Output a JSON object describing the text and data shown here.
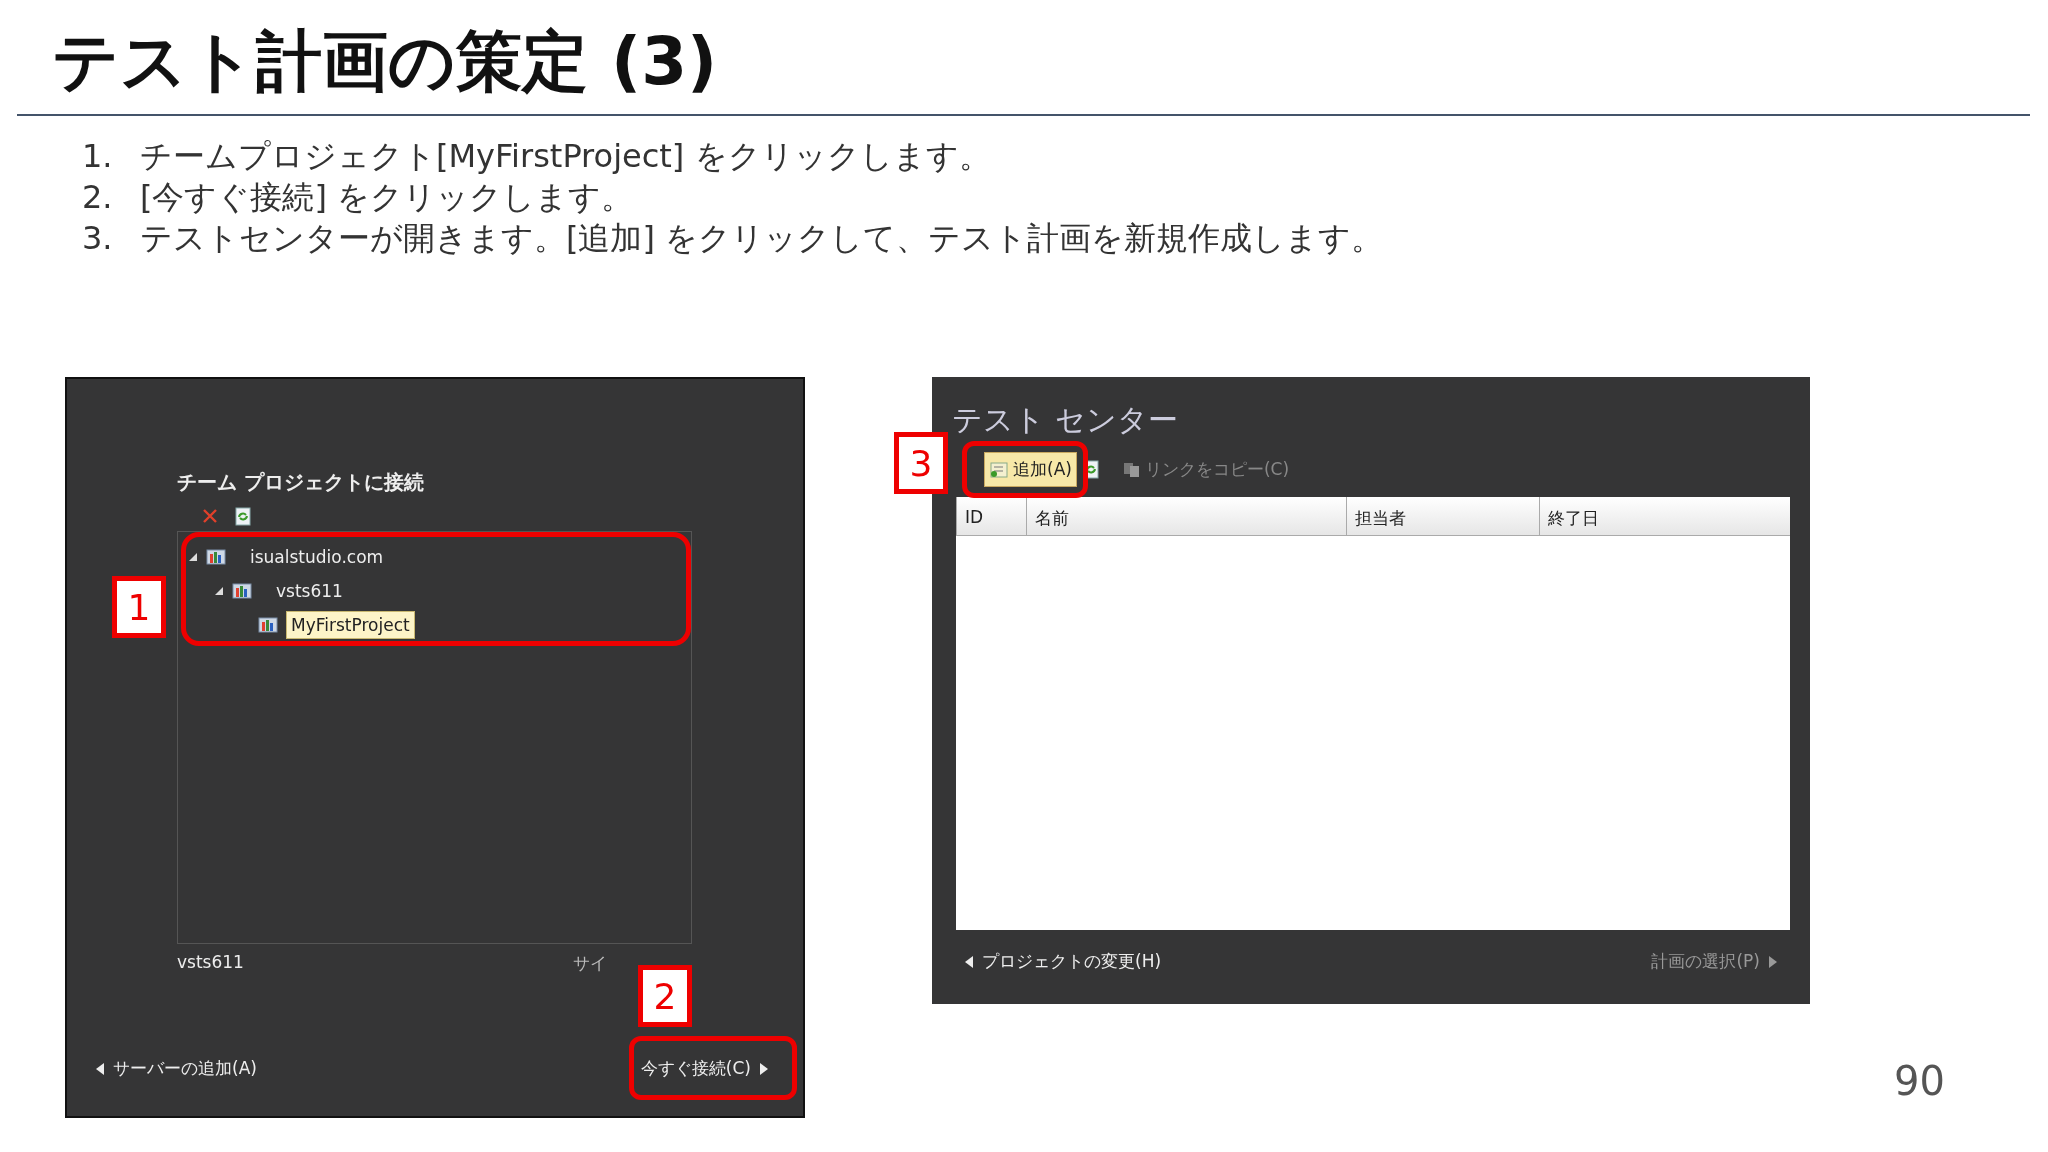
{
  "slide": {
    "title": "テスト計画の策定 (3)",
    "steps": [
      {
        "number": "1.",
        "text": "チームプロジェクト[MyFirstProject] をクリックします。"
      },
      {
        "number": "2.",
        "text": "[今すぐ接続] をクリックします。"
      },
      {
        "number": "3.",
        "text": "テストセンターが開きます。[追加] をクリックして、テスト計画を新規作成します。"
      }
    ],
    "page_number": "90"
  },
  "connect_dialog": {
    "heading": "チーム プロジェクトに接続",
    "tree": [
      {
        "label": "isualstudio.com",
        "expanded": true,
        "selected": false,
        "children": [
          {
            "label": "vsts611",
            "expanded": true,
            "selected": false,
            "children": [
              {
                "label": "MyFirstProject",
                "selected": true
              }
            ]
          }
        ]
      }
    ],
    "user": "vsts611",
    "sign_out": "サイ",
    "back_link": "サーバーの追加(A)",
    "next_button": "今すぐ接続(C)"
  },
  "test_center": {
    "title": "テスト センター",
    "toolbar": [
      {
        "label": "追加(A)",
        "disabled": false
      },
      {
        "label": "リンクをコピー(C)",
        "disabled": true
      }
    ],
    "columns": [
      "ID",
      "名前",
      "担当者",
      "終了日"
    ],
    "back_link": "プロジェクトの変更(H)",
    "next_link": "計画の選択(P)",
    "next_disabled": true
  },
  "callouts": [
    "1",
    "2",
    "3"
  ]
}
